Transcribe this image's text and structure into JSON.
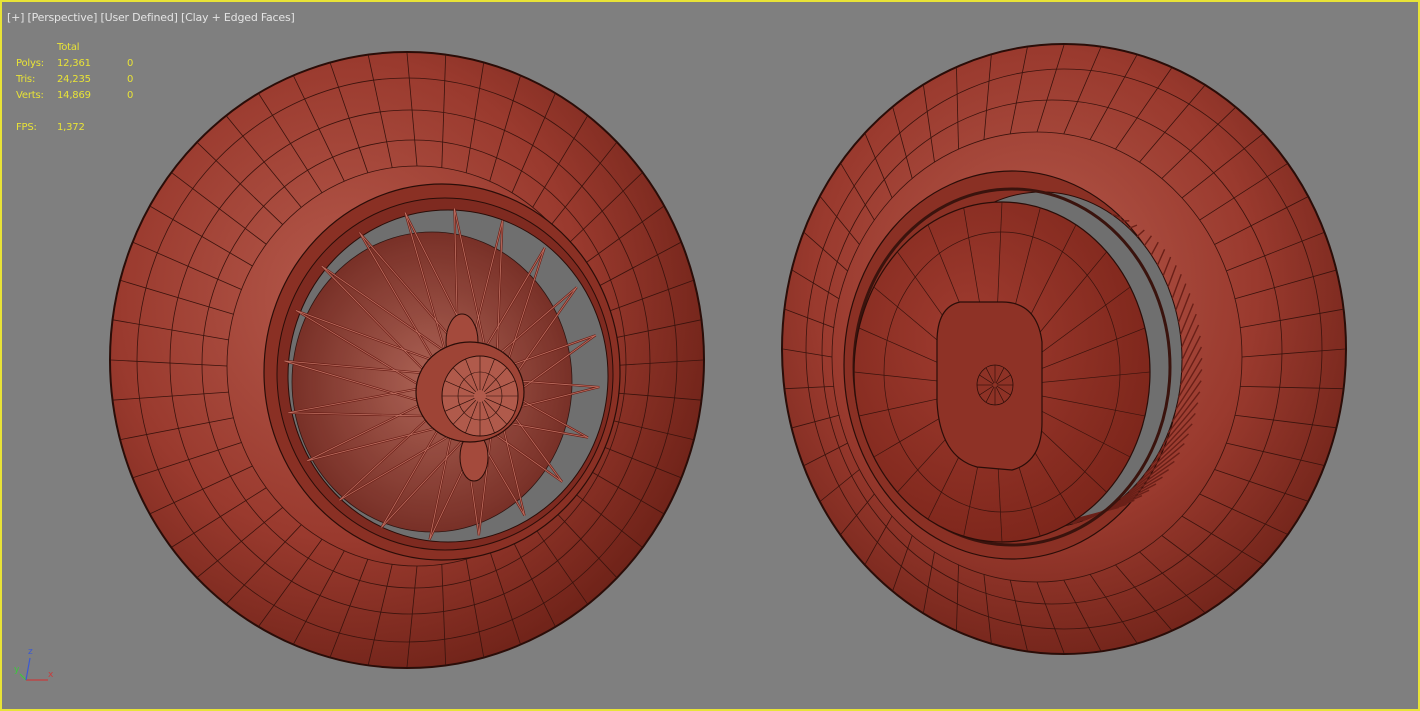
{
  "viewport": {
    "label_parts": [
      "[+]",
      "[Perspective]",
      "[User Defined]",
      "[Clay + Edged Faces]"
    ],
    "border_color": "#e8e337",
    "background_color": "#7f7f7f"
  },
  "stats": {
    "header": "Total",
    "rows": [
      {
        "label": "Polys:",
        "total": "12,361",
        "selected": "0"
      },
      {
        "label": "Tris:",
        "total": "24,235",
        "selected": "0"
      },
      {
        "label": "Verts:",
        "total": "14,869",
        "selected": "0"
      }
    ],
    "fps_label": "FPS:",
    "fps_value": "1,372",
    "text_color": "#e8e337"
  },
  "scene": {
    "objects": [
      "wheel-wire-spoke-front",
      "wheel-rear-hubcap"
    ],
    "clay_color": "#9a3a2e",
    "edge_color": "#2a0d08"
  },
  "axis_gizmo": {
    "x_label": "x",
    "y_label": "y",
    "z_label": "z",
    "x_color": "#c83c3c",
    "y_color": "#3cc83c",
    "z_color": "#3c5ad2"
  }
}
